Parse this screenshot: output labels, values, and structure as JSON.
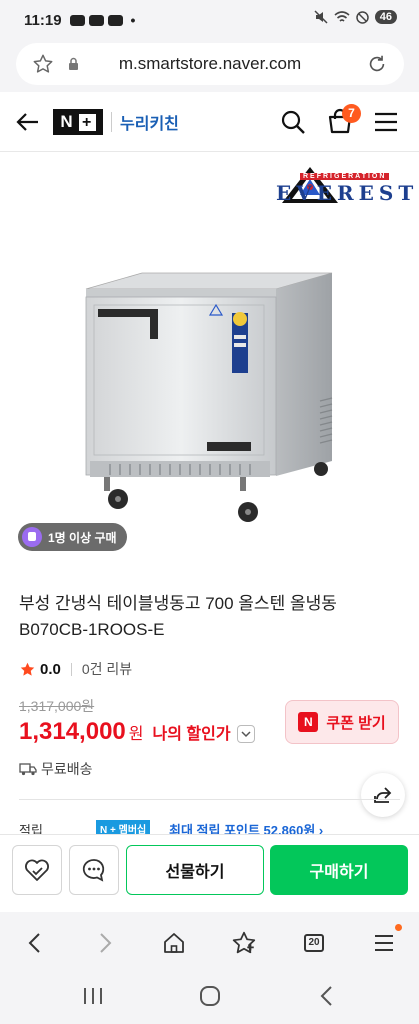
{
  "status_bar": {
    "time": "11:19",
    "dot": "•",
    "battery": "46"
  },
  "browser": {
    "url": "m.smartstore.naver.com",
    "tabs_count": "20"
  },
  "header": {
    "nplus_letter": "N",
    "nplus_plus": "+",
    "brand_name": "누리키친",
    "cart_count": "7"
  },
  "brand_logo": {
    "word": "EVEREST",
    "tagline": "REFRIGERATION"
  },
  "badge": {
    "label": "1명 이상 구매"
  },
  "product": {
    "title_line1": "부성 간냉식 테이블냉동고 700 올스텐 올냉동",
    "title_line2": "B070CB-1ROOS-E",
    "rating": "0.0",
    "reviews": "0건 리뷰",
    "original_price": "1,317,000원",
    "sale_price": "1,314,000",
    "price_unit": "원",
    "my_discount": "나의 할인가",
    "coupon_label": "쿠폰 받기",
    "coupon_icon_letter": "N",
    "shipping": "무료배송",
    "points_label": "적립",
    "points_badge": "N + 멤버십",
    "points_text": "최대 적립 포인트 52,860원 ›"
  },
  "actions": {
    "gift": "선물하기",
    "buy": "구매하기"
  },
  "colors": {
    "naver_green": "#03c75a",
    "price_red": "#e8101e",
    "cart_badge": "#ff5a1f"
  },
  "icons": [
    "star-outline-icon",
    "lock-icon",
    "reload-icon",
    "back-arrow-icon",
    "search-icon",
    "cart-icon",
    "hamburger-menu-icon",
    "star-rating-icon",
    "truck-icon",
    "share-icon",
    "heart-icon",
    "chat-icon",
    "home-icon",
    "bookmark-star-icon"
  ]
}
